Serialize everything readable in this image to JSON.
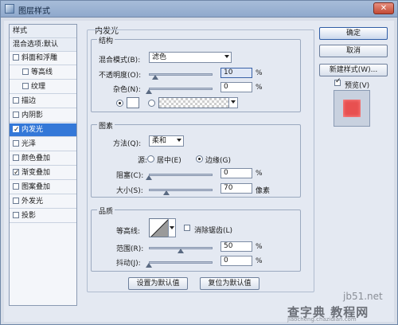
{
  "window": {
    "title": "图层样式",
    "close_label": "✕"
  },
  "styles_list": {
    "header": "样式",
    "blend_options": "混合选项:默认",
    "items": [
      {
        "label": "斜面和浮雕",
        "checked": false,
        "indent": false,
        "selected": false
      },
      {
        "label": "等高线",
        "checked": false,
        "indent": true,
        "selected": false
      },
      {
        "label": "纹理",
        "checked": false,
        "indent": true,
        "selected": false
      },
      {
        "label": "描边",
        "checked": false,
        "indent": false,
        "selected": false
      },
      {
        "label": "内阴影",
        "checked": false,
        "indent": false,
        "selected": false
      },
      {
        "label": "内发光",
        "checked": true,
        "indent": false,
        "selected": true
      },
      {
        "label": "光泽",
        "checked": false,
        "indent": false,
        "selected": false
      },
      {
        "label": "颜色叠加",
        "checked": false,
        "indent": false,
        "selected": false
      },
      {
        "label": "渐变叠加",
        "checked": true,
        "indent": false,
        "selected": false
      },
      {
        "label": "图案叠加",
        "checked": false,
        "indent": false,
        "selected": false
      },
      {
        "label": "外发光",
        "checked": false,
        "indent": false,
        "selected": false
      },
      {
        "label": "投影",
        "checked": false,
        "indent": false,
        "selected": false
      }
    ]
  },
  "inner_glow": {
    "title": "内发光",
    "structure": {
      "title": "结构",
      "blend_mode_label": "混合模式(B):",
      "blend_mode_value": "滤色",
      "opacity_label": "不透明度(O):",
      "opacity_value": "10",
      "opacity_level": 0.1,
      "noise_label": "杂色(N):",
      "noise_value": "0",
      "noise_level": 0.0,
      "percent": "%",
      "solid_color": "#ffffff"
    },
    "elements": {
      "title": "图素",
      "method_label": "方法(Q):",
      "method_value": "柔和",
      "source_label": "源:",
      "source_center": "居中(E)",
      "source_edge": "边缘(G)",
      "source_selected": "edge",
      "choke_label": "阻塞(C):",
      "choke_value": "0",
      "choke_level": 0.0,
      "size_label": "大小(S):",
      "size_value": "70",
      "size_level": 0.28,
      "percent": "%",
      "px": "像素"
    },
    "quality": {
      "title": "品质",
      "contour_label": "等高线:",
      "anti_alias_label": "消除锯齿(L)",
      "range_label": "范围(R):",
      "range_value": "50",
      "range_level": 0.5,
      "jitter_label": "抖动(J):",
      "jitter_value": "0",
      "jitter_level": 0.0,
      "percent": "%"
    },
    "make_default": "设置为默认值",
    "reset_default": "复位为默认值"
  },
  "buttons": {
    "ok": "确定",
    "cancel": "取消",
    "new_style": "新建样式(W)...",
    "preview_label": "预览(V)",
    "preview_checked": true
  },
  "preview_color": "#e85050",
  "watermark": {
    "line1": "jb51.net",
    "line2": "查字典 教程网",
    "line3": "jiaocheng.chazidian.com"
  }
}
